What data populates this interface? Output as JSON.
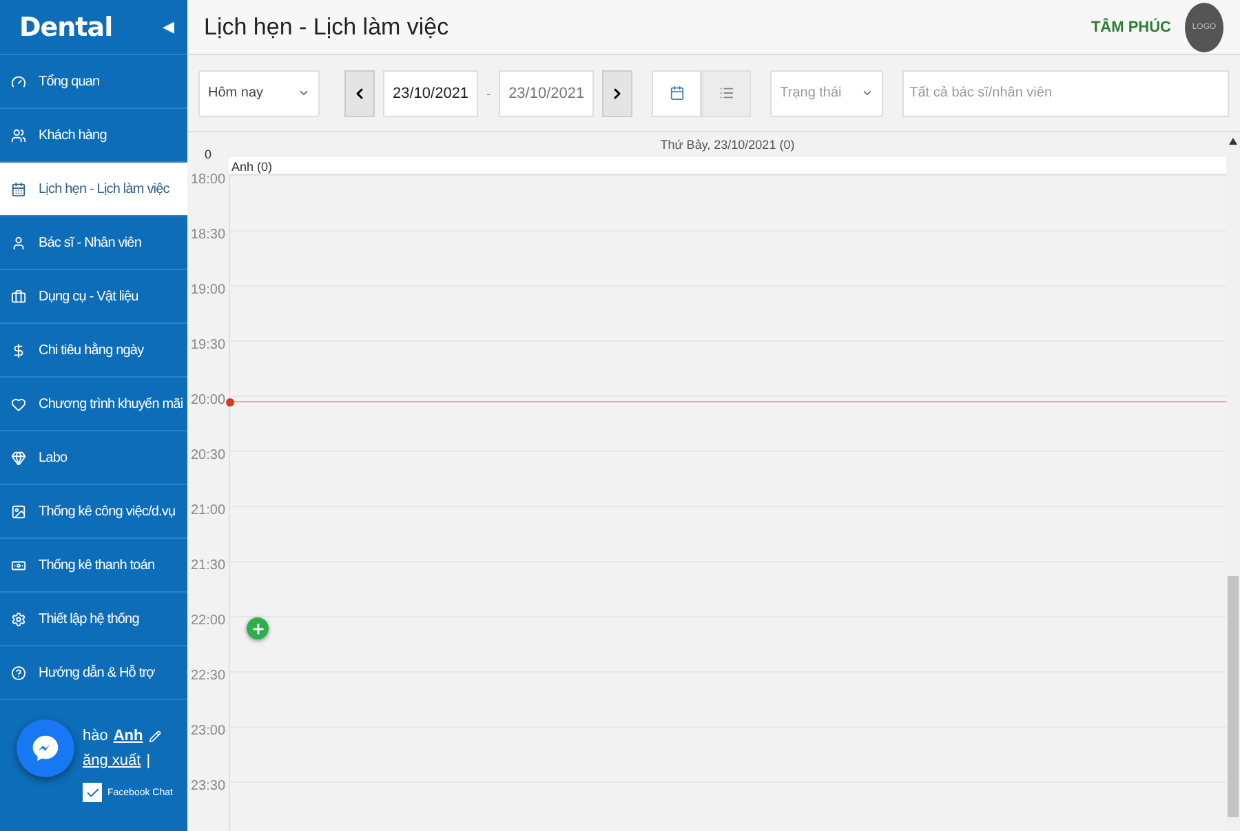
{
  "sidebar": {
    "logo": "Dental",
    "collapse": "◀",
    "items": [
      {
        "label": "Tổng quan",
        "selected": false
      },
      {
        "label": "Khách hàng",
        "selected": false
      },
      {
        "label": "Lịch hẹn - Lịch làm việc",
        "selected": true
      },
      {
        "label": "Bác sĩ - Nhân viên",
        "selected": false
      },
      {
        "label": "Dụng cụ - Vật liệu",
        "selected": false
      },
      {
        "label": "Chi tiêu hằng ngày",
        "selected": false
      },
      {
        "label": "Chương trình khuyến mãi",
        "selected": false
      },
      {
        "label": "Labo",
        "selected": false
      },
      {
        "label": "Thống kê công việc/d.vụ",
        "selected": false
      },
      {
        "label": "Thống kê thanh toán",
        "selected": false
      },
      {
        "label": "Thiết lập hệ thống",
        "selected": false
      },
      {
        "label": "Hướng dẫn & Hỗ trợ",
        "selected": false
      }
    ],
    "greeting": "hào",
    "user": "Anh",
    "logout": "ăng xuất",
    "separator": "|",
    "chat": "Facebook Chat",
    "chat_checked": true
  },
  "header": {
    "title": "Lịch hẹn - Lịch làm việc",
    "brand": "TÂM PHÚC",
    "logo": "LOGO"
  },
  "toolbar": {
    "range": "Hôm nay",
    "date_from": "23/10/2021",
    "dash": "-",
    "date_to": "23/10/2021",
    "views": [
      {
        "kind": "calendar",
        "selected": true
      },
      {
        "kind": "list",
        "selected": false
      }
    ],
    "status": {
      "placeholder": "Trạng thái"
    },
    "staff": {
      "placeholder": "Tất cả bác sĩ/nhân viên"
    }
  },
  "calendar": {
    "count": "0",
    "day": "Thứ Bảy, 23/10/2021 (0)",
    "resource": "Anh (0)",
    "times": [
      {
        "label": "18:00",
        "now": false
      },
      {
        "label": "18:30",
        "now": false
      },
      {
        "label": "19:00",
        "now": false
      },
      {
        "label": "19:30",
        "now": false
      },
      {
        "label": "20:00",
        "now": true
      },
      {
        "label": "20:30",
        "now": false
      },
      {
        "label": "21:00",
        "now": false
      },
      {
        "label": "21:30",
        "now": false
      },
      {
        "label": "22:00",
        "now": false
      },
      {
        "label": "22:30",
        "now": false
      },
      {
        "label": "23:00",
        "now": false
      },
      {
        "label": "23:30",
        "now": false
      }
    ]
  }
}
